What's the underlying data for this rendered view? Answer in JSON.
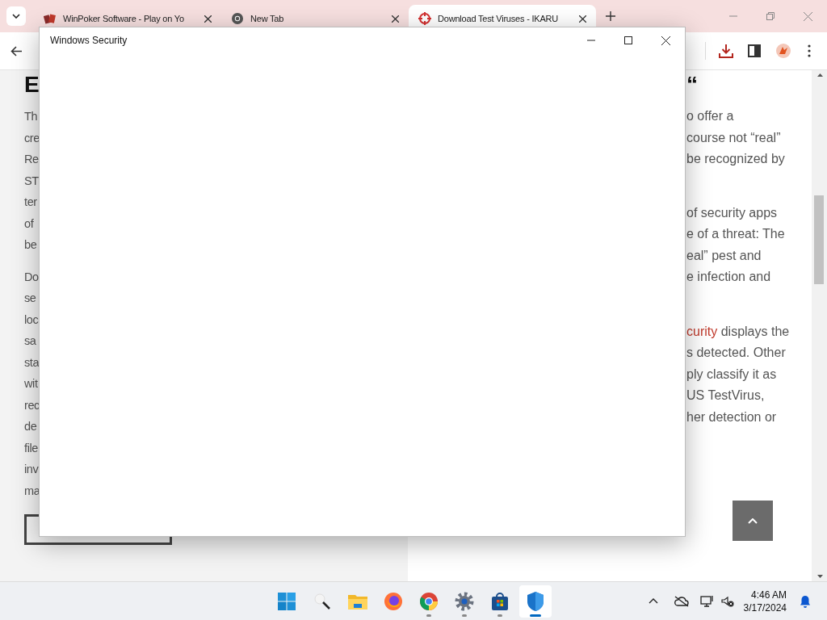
{
  "browser": {
    "tabs": [
      {
        "title": "WinPoker Software - Play on Yo",
        "kind": "cards",
        "selected": false
      },
      {
        "title": "New Tab",
        "kind": "chrome",
        "selected": false
      },
      {
        "title": "Download Test Viruses - IKARU",
        "kind": "target",
        "selected": true
      }
    ]
  },
  "page": {
    "left_heading": "E",
    "left_paragraphs": [
      [
        "Th",
        "cre",
        "Re",
        "ST",
        "ter",
        "of",
        "be"
      ],
      [
        "Do",
        "se",
        "loc",
        "sa",
        "sta",
        "wit",
        "rec",
        "de",
        "file",
        "inv",
        "ma"
      ]
    ],
    "right_heading": "“",
    "right_paragraphs": [
      [
        "o offer a",
        "course not “real”",
        "be recognized by"
      ],
      [
        "of security apps",
        "e of a threat: The",
        "eal” pest and",
        "e infection and"
      ],
      [
        "**curity** displays the",
        "s detected. Other",
        "ply classify it as",
        "US TestVirus,",
        "her detection or"
      ]
    ]
  },
  "dialog": {
    "title": "Windows Security"
  },
  "taskbar": {
    "apps": [
      {
        "kind": "start",
        "running": false,
        "selected": false
      },
      {
        "kind": "search",
        "running": false,
        "selected": false
      },
      {
        "kind": "folder",
        "running": false,
        "selected": false
      },
      {
        "kind": "firefox",
        "running": false,
        "selected": false
      },
      {
        "kind": "chrome",
        "running": true,
        "selected": false
      },
      {
        "kind": "settings",
        "running": true,
        "selected": false
      },
      {
        "kind": "store",
        "running": true,
        "selected": false
      },
      {
        "kind": "shield",
        "running": true,
        "selected": true
      }
    ],
    "time": "4:46 AM",
    "date": "3/17/2024"
  }
}
